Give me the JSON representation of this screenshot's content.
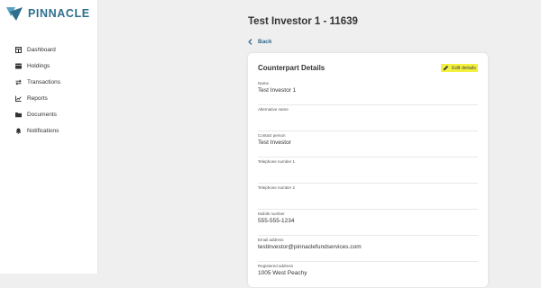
{
  "brand": {
    "name": "PINNACLE"
  },
  "sidebar": {
    "items": [
      {
        "label": "Dashboard",
        "icon": "dashboard-icon"
      },
      {
        "label": "Holdings",
        "icon": "holdings-icon"
      },
      {
        "label": "Transactions",
        "icon": "transactions-icon"
      },
      {
        "label": "Reports",
        "icon": "reports-icon"
      },
      {
        "label": "Documents",
        "icon": "documents-icon"
      },
      {
        "label": "Notifications",
        "icon": "bell-icon"
      }
    ]
  },
  "header": {
    "title": "Test Investor 1 - 11639",
    "back_label": "Back"
  },
  "card": {
    "title": "Counterpart Details",
    "edit_label": "Edit details",
    "fields": [
      {
        "label": "Name",
        "value": "Test Investor 1"
      },
      {
        "label": "Alternative name",
        "value": ""
      },
      {
        "label": "Contact person",
        "value": "Test Investor"
      },
      {
        "label": "Telephone number 1",
        "value": ""
      },
      {
        "label": "Telephone number 2",
        "value": ""
      },
      {
        "label": "Mobile number",
        "value": "555-555-1234"
      },
      {
        "label": "Email address",
        "value": "testinvestor@pinnaclefundservices.com"
      },
      {
        "label": "Registered address",
        "value": "1005 West Peachy"
      }
    ]
  },
  "colors": {
    "brand": "#2e6f8e",
    "link": "#2d6a8a",
    "highlight": "#f3f13d",
    "background": "#efefef"
  }
}
